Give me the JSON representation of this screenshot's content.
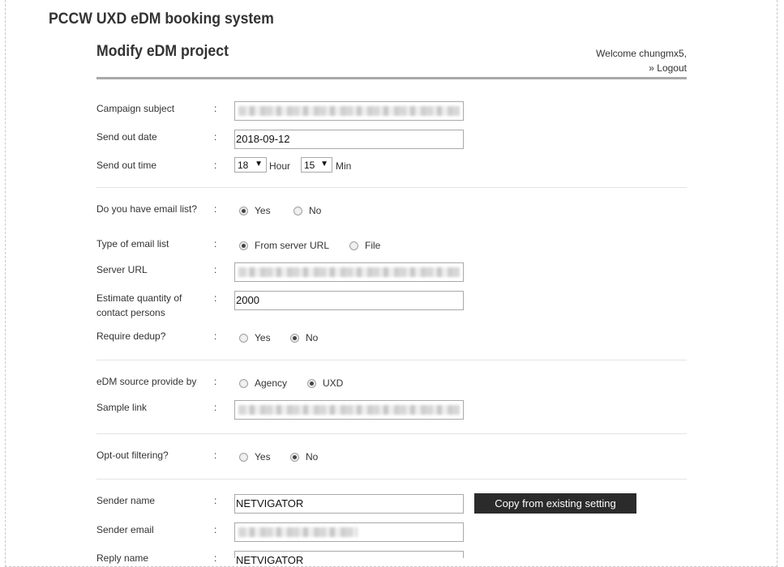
{
  "app_title": "PCCW UXD eDM booking system",
  "page_title": "Modify eDM project",
  "welcome": {
    "greeting": "Welcome chungmx5,",
    "logout": "» Logout"
  },
  "colon": ":",
  "fields": {
    "campaign_subject": {
      "label": "Campaign subject"
    },
    "send_out_date": {
      "label": "Send out date",
      "value": "2018-09-12"
    },
    "send_out_time": {
      "label": "Send out time",
      "hour": "18",
      "hour_unit": "Hour",
      "min": "15",
      "min_unit": "Min"
    },
    "has_email_list": {
      "label": "Do you have email list?",
      "options": [
        "Yes",
        "No"
      ],
      "selected": "Yes"
    },
    "email_list_type": {
      "label": "Type of email list",
      "options": [
        "From server URL",
        "File"
      ],
      "selected": "From server URL"
    },
    "server_url": {
      "label": "Server URL"
    },
    "estimate_quantity": {
      "label_line1": "Estimate quantity of",
      "label_line2": "contact persons",
      "value": "2000"
    },
    "require_dedup": {
      "label": "Require dedup?",
      "options": [
        "Yes",
        "No"
      ],
      "selected": "No"
    },
    "edm_source": {
      "label": "eDM source provide by",
      "options": [
        "Agency",
        "UXD"
      ],
      "selected": "UXD"
    },
    "sample_link": {
      "label": "Sample link"
    },
    "opt_out": {
      "label": "Opt-out filtering?",
      "options": [
        "Yes",
        "No"
      ],
      "selected": "No"
    },
    "sender_name": {
      "label": "Sender name",
      "value": "NETVIGATOR"
    },
    "sender_email": {
      "label": "Sender email"
    },
    "reply_name": {
      "label": "Reply name",
      "value": "NETVIGATOR"
    }
  },
  "copy_button": "Copy from existing setting",
  "icons": {
    "select_caret": "▼"
  }
}
